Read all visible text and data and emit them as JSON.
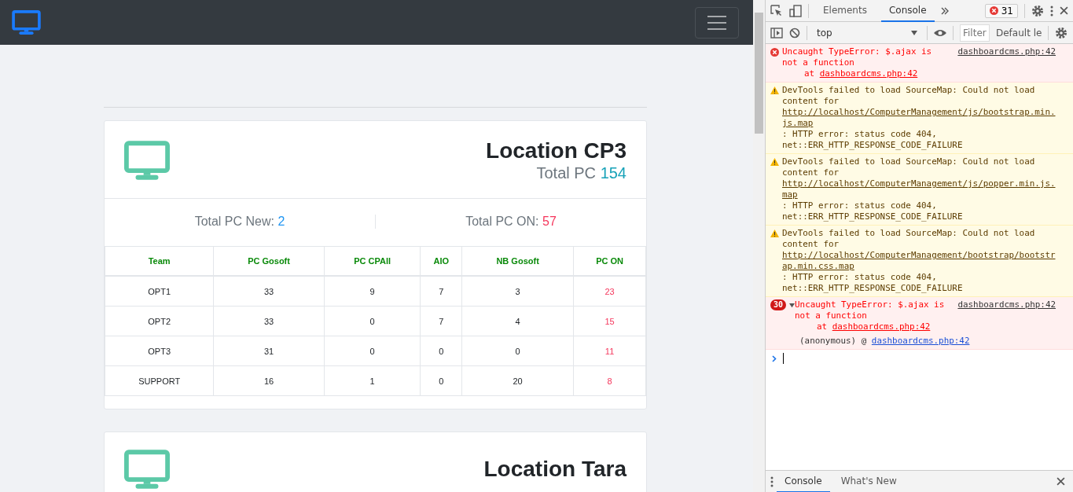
{
  "cards": [
    {
      "title": "Location CP3",
      "total_label": "Total PC",
      "total_value": "154",
      "stats": [
        {
          "label": "Total PC New:",
          "value": "2",
          "kind": "new"
        },
        {
          "label": "Total PC ON:",
          "value": "57",
          "kind": "on"
        }
      ],
      "table": {
        "columns": [
          {
            "label": "Team",
            "kind": "count"
          },
          {
            "label": "PC Gosoft",
            "kind": "count"
          },
          {
            "label": "PC CPAll",
            "kind": "count"
          },
          {
            "label": "AIO",
            "kind": "count"
          },
          {
            "label": "NB Gosoft",
            "kind": "count"
          },
          {
            "label": "PC ON",
            "kind": "on"
          }
        ],
        "rows": [
          [
            "OPT1",
            "33",
            "9",
            "7",
            "3",
            "23"
          ],
          [
            "OPT2",
            "33",
            "0",
            "7",
            "4",
            "15"
          ],
          [
            "OPT3",
            "31",
            "0",
            "0",
            "0",
            "11"
          ],
          [
            "SUPPORT",
            "16",
            "1",
            "0",
            "20",
            "8"
          ]
        ]
      }
    },
    {
      "title": "Location Tara"
    }
  ],
  "devtools": {
    "tabs": [
      {
        "label": "Elements",
        "selected": false
      },
      {
        "label": "Console",
        "selected": true
      }
    ],
    "error_count": "31",
    "context": "top",
    "filter_placeholder": "Filter",
    "levels": "Default le",
    "messages": [
      {
        "kind": "error",
        "text": "Uncaught TypeError: $.ajax is not a function",
        "source": "dashboardcms.php:42",
        "at_label": "at",
        "at_link": "dashboardcms.php:42"
      },
      {
        "kind": "warning",
        "text_before": "DevTools failed to load SourceMap: Could not load content for ",
        "link": "http://localhost/ComputerManagement/js/bootstrap.min.js.map",
        "text_after": ": HTTP error: status code 404, net::ERR_HTTP_RESPONSE_CODE_FAILURE"
      },
      {
        "kind": "warning",
        "text_before": "DevTools failed to load SourceMap: Could not load content for ",
        "link": "http://localhost/ComputerManagement/js/popper.min.js.map",
        "text_after": ": HTTP error: status code 404, net::ERR_HTTP_RESPONSE_CODE_FAILURE"
      },
      {
        "kind": "warning",
        "text_before": "DevTools failed to load SourceMap: Could not load content for ",
        "link": "http://localhost/ComputerManagement/bootstrap/bootstrap.min.css.map",
        "text_after": ": HTTP error: status code 404, net::ERR_HTTP_RESPONSE_CODE_FAILURE"
      },
      {
        "kind": "error",
        "repeat": "30",
        "expanded": true,
        "text": "Uncaught TypeError: $.ajax is not a function",
        "source": "dashboardcms.php:42",
        "at_label": "at",
        "at_link": "dashboardcms.php:42",
        "stack_label": "(anonymous) @",
        "stack_link": "dashboardcms.php:42"
      }
    ],
    "drawer_tabs": [
      {
        "label": "Console",
        "selected": true
      },
      {
        "label": "What's New",
        "selected": false
      }
    ]
  }
}
